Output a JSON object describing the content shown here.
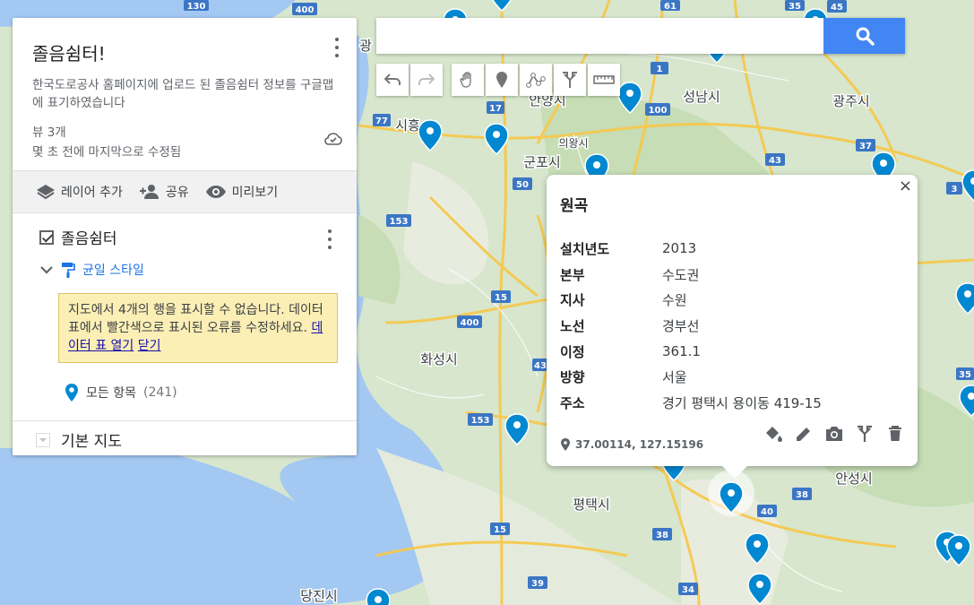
{
  "map": {
    "cities": [
      "광",
      "안양시",
      "성남시",
      "광주시",
      "시흥",
      "의왕시",
      "군포시",
      "화성시",
      "평택시",
      "안성시",
      "당진시"
    ],
    "route_shields": [
      "130",
      "400",
      "61",
      "35",
      "45",
      "1",
      "100",
      "77",
      "17",
      "37",
      "50",
      "43",
      "3",
      "153",
      "15",
      "400",
      "43",
      "153",
      "35",
      "38",
      "40",
      "15",
      "38",
      "39",
      "34"
    ]
  },
  "sidebar": {
    "title": "졸음쉼터!",
    "description": "한국도로공사 홈페이지에 업로드 된 졸음쉼터 정보를 구글맵에 표기하였습니다",
    "views": "뷰 3개",
    "modified": "몇 초 전에 마지막으로 수정됨",
    "actions": {
      "add_layer": "레이어 추가",
      "share": "공유",
      "preview": "미리보기"
    },
    "layer": {
      "name": "졸음쉼터",
      "style": "균일 스타일",
      "warning": "지도에서 4개의 행을 표시할 수 없습니다. 데이터 표에서 빨간색으로 표시된 오류를 수정하세요.",
      "open_table": "데이터 표 열기",
      "close": "닫기",
      "all_items": "모든 항목",
      "count": "(241)"
    },
    "base_map": "기본 지도"
  },
  "search": {
    "value": "",
    "placeholder": ""
  },
  "popup": {
    "title": "원곡",
    "close": "×",
    "rows": [
      {
        "k": "설치년도",
        "v": "2013"
      },
      {
        "k": "본부",
        "v": "수도권"
      },
      {
        "k": "지사",
        "v": "수원"
      },
      {
        "k": "노선",
        "v": "경부선"
      },
      {
        "k": "이정",
        "v": "361.1"
      },
      {
        "k": "방향",
        "v": "서울"
      },
      {
        "k": "주소",
        "v": "경기 평택시 용이동 419-15"
      }
    ],
    "coords": "37.00114, 127.15196"
  },
  "colors": {
    "accent": "#4285f4",
    "pin": "#0288d1"
  }
}
